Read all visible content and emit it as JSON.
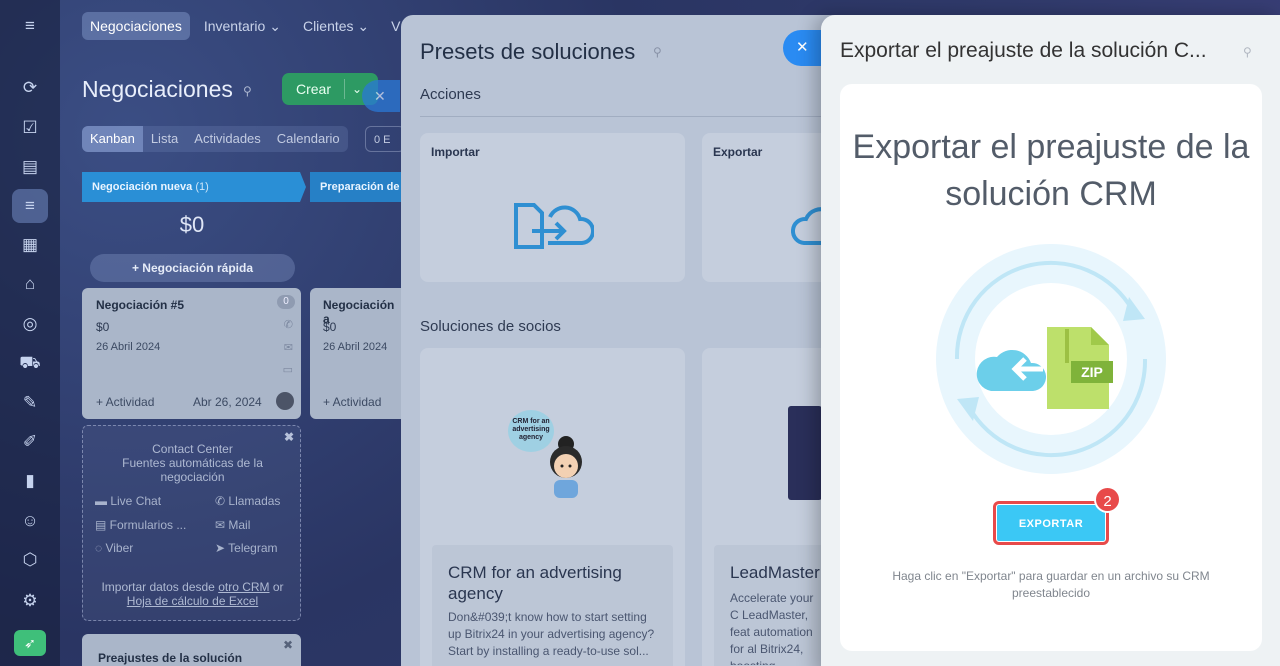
{
  "topnav": {
    "items": [
      "Negociaciones",
      "Inventario ⌄",
      "Clientes ⌄",
      "V"
    ]
  },
  "page": {
    "title": "Negociaciones",
    "create_label": "Crear",
    "view_tabs": [
      "Kanban",
      "Lista",
      "Actividades",
      "Calendario"
    ],
    "chip_label": "0 E"
  },
  "kanban": {
    "col1_title": "Negociación nueva",
    "col1_count": "(1)",
    "col2_title": "Preparación de",
    "sum": "$0",
    "quick_add": "+ Negociación rápida",
    "card1": {
      "name": "Negociación #5",
      "amount": "$0",
      "date": "26 Abril 2024",
      "badge": "0",
      "activity": "+ Actividad",
      "due": "Abr 26, 2024"
    },
    "card2": {
      "name": "Negociación a",
      "amount": "$0",
      "date": "26 Abril 2024",
      "activity": "+ Actividad"
    },
    "contact_center": {
      "title": "Contact Center",
      "subtitle1": "Fuentes automáticas de la",
      "subtitle2": "negociación",
      "live_chat": "Live Chat",
      "llamadas": "Llamadas",
      "formularios": "Formularios ...",
      "mail": "Mail",
      "viber": "Viber",
      "telegram": "Telegram",
      "import_prefix": "Importar datos desde",
      "import_link1": "otro CRM",
      "import_or": "or",
      "import_link2": "Hoja de cálculo de Excel"
    },
    "presets_card": "Preajustes de la solución"
  },
  "middle": {
    "title": "Presets de soluciones",
    "section_actions": "Acciones",
    "tile_import": "Importar",
    "tile_export": "Exportar",
    "section_partners": "Soluciones de socios",
    "sol1": {
      "title": "CRM for an advertising agency",
      "desc": "Don&#039;t know how to start setting up Bitrix24 in your advertising agency? Start by installing a ready-to-use sol...",
      "bubble": "CRM for an advertising agency"
    },
    "sol2": {
      "title": "LeadMaster",
      "desc": "Accelerate your C LeadMaster, feat automation for al Bitrix24, boosting productivity. Our"
    }
  },
  "right": {
    "title": "Exportar el preajuste de la solución C...",
    "heading": "Exportar el preajuste de la solución CRM",
    "zip_label": "ZIP",
    "export_button": "EXPORTAR",
    "step_badge": "2",
    "hint": "Haga clic en \"Exportar\" para guardar en un archivo su CRM preestablecido"
  },
  "colors": {
    "accent": "#3bc8f5",
    "highlight": "#e84a4a",
    "kanban_head": "#2a8fd6",
    "create_green": "#2d9a63"
  }
}
